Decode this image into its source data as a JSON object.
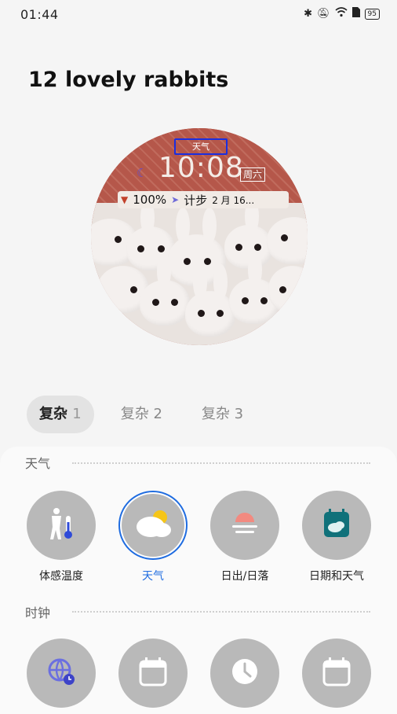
{
  "status": {
    "time": "01:44",
    "battery": "95"
  },
  "header": {
    "title": "12 lovely rabbits"
  },
  "watchface": {
    "weather_tag": "天气",
    "time": "10:08",
    "weekday": "周六",
    "battery_pct": "100%",
    "steps_label": "计步",
    "date": "2 月 16..."
  },
  "tabs": [
    {
      "label": "复杂",
      "num": "1"
    },
    {
      "label": "复杂",
      "num": "2"
    },
    {
      "label": "复杂",
      "num": "3"
    }
  ],
  "sections": {
    "weather": {
      "title": "天气",
      "items": [
        {
          "label": "体感温度",
          "icon": "feels-like-temperature-icon"
        },
        {
          "label": "天气",
          "icon": "weather-icon"
        },
        {
          "label": "日出/日落",
          "icon": "sunrise-sunset-icon"
        },
        {
          "label": "日期和天气",
          "icon": "date-weather-icon"
        }
      ]
    },
    "clock": {
      "title": "时钟",
      "items": [
        {
          "icon": "world-clock-icon"
        },
        {
          "icon": "calendar-icon"
        },
        {
          "icon": "clock-icon"
        },
        {
          "icon": "calendar-icon"
        }
      ]
    }
  },
  "colors": {
    "accent": "#1f6ce0",
    "circle": "#b9b9b9"
  }
}
